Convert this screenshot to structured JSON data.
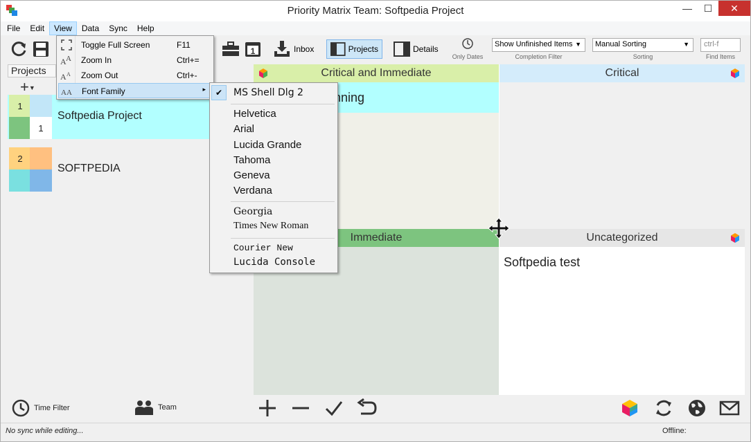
{
  "window": {
    "title": "Priority Matrix Team: Softpedia Project",
    "minimize": "—",
    "maximize": "☐",
    "close": "✕"
  },
  "menubar": {
    "items": [
      "File",
      "Edit",
      "View",
      "Data",
      "Sync",
      "Help"
    ]
  },
  "toolbar": {
    "inbox_label": "Inbox",
    "projects_label": "Projects",
    "details_label": "Details",
    "only_dates_label": "Only Dates",
    "completion_filter_value": "Show Unfinished Items",
    "completion_filter_caption": "Completion Filter",
    "sorting_value": "Manual Sorting",
    "sorting_caption": "Sorting",
    "find_placeholder": "ctrl-f",
    "find_caption": "Find Items"
  },
  "view_menu": {
    "items": [
      {
        "label": "Toggle Full Screen",
        "shortcut": "F11",
        "icon": "fullscreen-icon"
      },
      {
        "label": "Zoom In",
        "shortcut": "Ctrl+=",
        "icon": "zoom-in-icon"
      },
      {
        "label": "Zoom Out",
        "shortcut": "Ctrl+-",
        "icon": "zoom-out-icon"
      },
      {
        "label": "Font Family",
        "shortcut": "",
        "icon": "font-icon",
        "submenu_arrow": "▸"
      }
    ]
  },
  "font_menu": {
    "checked": "✔",
    "groups": [
      [
        "MS Shell Dlg 2"
      ],
      [
        "Helvetica",
        "Arial",
        "Lucida Grande",
        "Tahoma",
        "Geneva",
        "Verdana"
      ],
      [
        "Georgia",
        "Times New Roman"
      ],
      [
        "Courier New",
        "Lucida Console"
      ]
    ]
  },
  "projects": {
    "header": "Projects",
    "add_symbol": "+",
    "items": [
      {
        "name": "Softpedia Project",
        "q1": "1",
        "q4": "1"
      },
      {
        "name": "SOFTPEDIA",
        "q1": "2",
        "q4": ""
      }
    ]
  },
  "matrix": {
    "q1_title": "Critical and Immediate",
    "q2_title": "Critical",
    "q3_title": "Immediate",
    "q4_title": "Uncategorized",
    "q1_task_partial": "nning",
    "q4_task": "Softpedia test"
  },
  "bottombar": {
    "time_filter_label": "Time Filter",
    "team_label": "Team"
  },
  "status": {
    "left": "No sync while editing...",
    "right": "Offline:"
  },
  "colors": {
    "q1": "#d9efa9",
    "q2": "#d4ecfb",
    "q3": "#7dc47f",
    "q4": "#e6e6e6",
    "selected_project": "#b2ffff",
    "accent": "#7eb4ea"
  }
}
